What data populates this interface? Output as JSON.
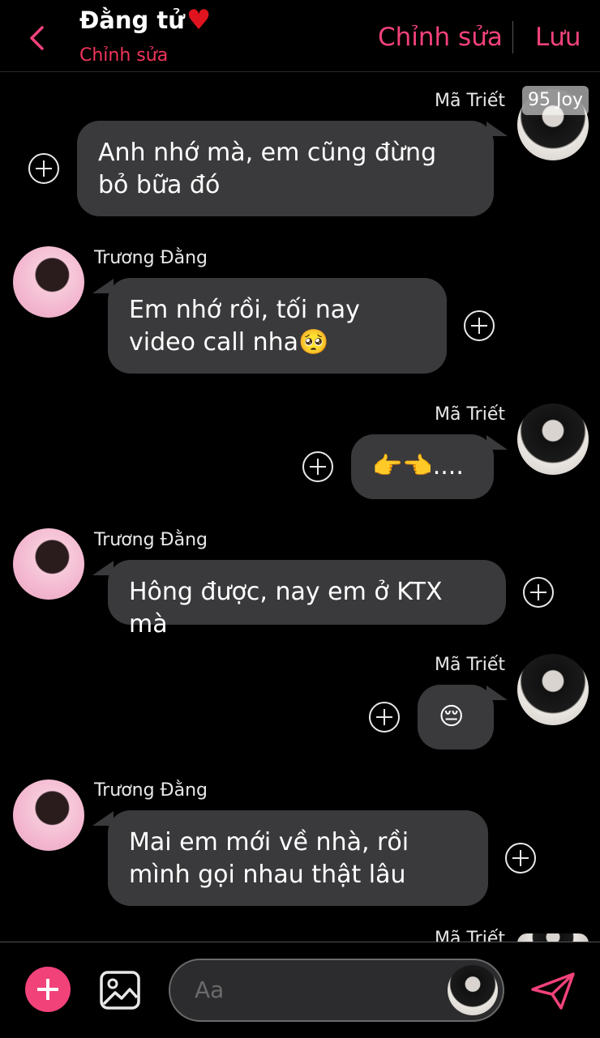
{
  "header": {
    "title": "Đằng tử",
    "title_icon": "heart-icon",
    "subtitle": "Chỉnh sửa",
    "edit_label": "Chỉnh sửa",
    "save_label": "Lưu",
    "accent_color": "#f2427a"
  },
  "overlay_badge": "95 Joy",
  "messages": [
    {
      "sender": "Mã Triết",
      "side": "right",
      "text": "Anh nhớ mà, em cũng đừng bỏ bữa đó"
    },
    {
      "sender": "Trương Đằng",
      "side": "left",
      "text": "Em nhớ rồi, tối nay video call nha🥺"
    },
    {
      "sender": "Mã Triết",
      "side": "right",
      "text": "👉👈...."
    },
    {
      "sender": "Trương Đằng",
      "side": "left",
      "text": "Hông được, nay em ở KTX mà"
    },
    {
      "sender": "Mã Triết",
      "side": "right",
      "text": "😔"
    },
    {
      "sender": "Trương Đằng",
      "side": "left",
      "text": "Mai em mới về nhà, rồi mình gọi nhau thật lâu"
    },
    {
      "sender": "Mã Triết",
      "side": "right",
      "text": ""
    }
  ],
  "composer": {
    "placeholder": "Aa",
    "add_icon": "plus-icon",
    "image_icon": "image-icon",
    "send_icon": "send-icon"
  }
}
